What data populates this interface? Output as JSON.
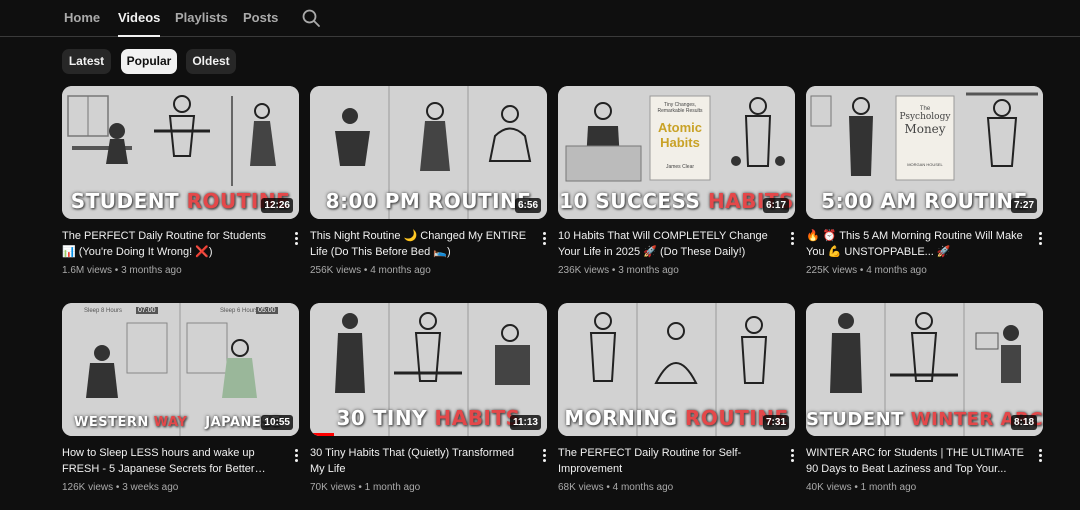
{
  "tabs": [
    {
      "label": "Home"
    },
    {
      "label": "Videos"
    },
    {
      "label": "Playlists"
    },
    {
      "label": "Posts"
    }
  ],
  "active_tab": "Videos",
  "chips": [
    {
      "label": "Latest"
    },
    {
      "label": "Popular"
    },
    {
      "label": "Oldest"
    }
  ],
  "selected_chip": "Popular",
  "accent_colors": {
    "highlight": "#e4484a",
    "progress": "#ff0000"
  },
  "videos": [
    {
      "thumb_text": "STUDENT ",
      "thumb_highlight": "ROUTINE",
      "duration": "12:26",
      "title": "The PERFECT Daily Routine for Students 📊 (You're Doing It Wrong! ❌)",
      "views": "1.6M views",
      "age": "3 months ago"
    },
    {
      "thumb_text": "8:00 PM ROUTINE",
      "thumb_highlight": "",
      "duration": "6:56",
      "title": "This Night Routine 🌙 Changed My ENTIRE Life (Do This Before Bed 🛌)",
      "views": "256K views",
      "age": "4 months ago"
    },
    {
      "thumb_text": "10 SUCCESS ",
      "thumb_highlight": "HABITS",
      "duration": "6:17",
      "title": "10 Habits That Will COMPLETELY Change Your Life in 2025 🚀 (Do These Daily!)",
      "views": "236K views",
      "age": "3 months ago",
      "book_small": "Tiny Changes, Remarkable Results",
      "book_title_1": "Atomic",
      "book_title_2": "Habits",
      "book_author": "James Clear"
    },
    {
      "thumb_text": "5:00 AM ROUTINE",
      "thumb_highlight": "",
      "duration": "7:27",
      "title": "🔥 ⏰ This 5 AM Morning Routine Will Make You 💪 UNSTOPPABLE... 🚀",
      "views": "225K views",
      "age": "4 months ago",
      "book_small": "The",
      "book_title_1": "Psychology",
      "book_title_2": "Money",
      "book_author": "MORGAN HOUSEL"
    },
    {
      "thumb_text": "WESTERN ",
      "thumb_highlight": "WAY",
      "thumb_text2": "JAPANESE",
      "duration": "10:55",
      "title": "How to Sleep LESS hours and wake up FRESH - 5 Japanese Secrets for Better Sle...",
      "views": "126K views",
      "age": "3 weeks ago",
      "label_left": "Sleep 8 Hours",
      "time_left": "07:00",
      "label_right": "Sleep 6 Hours",
      "time_right": "05:00"
    },
    {
      "thumb_text": "30 TINY ",
      "thumb_highlight": "HABITS",
      "duration": "11:13",
      "title": "30 Tiny Habits That (Quietly) Transformed My Life",
      "views": "70K views",
      "age": "1 month ago",
      "progress": 0.1
    },
    {
      "thumb_text": "MORNING ",
      "thumb_highlight": "ROUTINE",
      "duration": "7:31",
      "title": "The PERFECT Daily Routine for Self-Improvement",
      "views": "68K views",
      "age": "4 months ago"
    },
    {
      "thumb_text": "STUDENT ",
      "thumb_highlight": "WINTER ARC",
      "duration": "8:18",
      "title": "WINTER ARC for Students | THE ULTIMATE 90 Days to Beat Laziness and Top Your...",
      "views": "40K views",
      "age": "1 month ago"
    }
  ]
}
